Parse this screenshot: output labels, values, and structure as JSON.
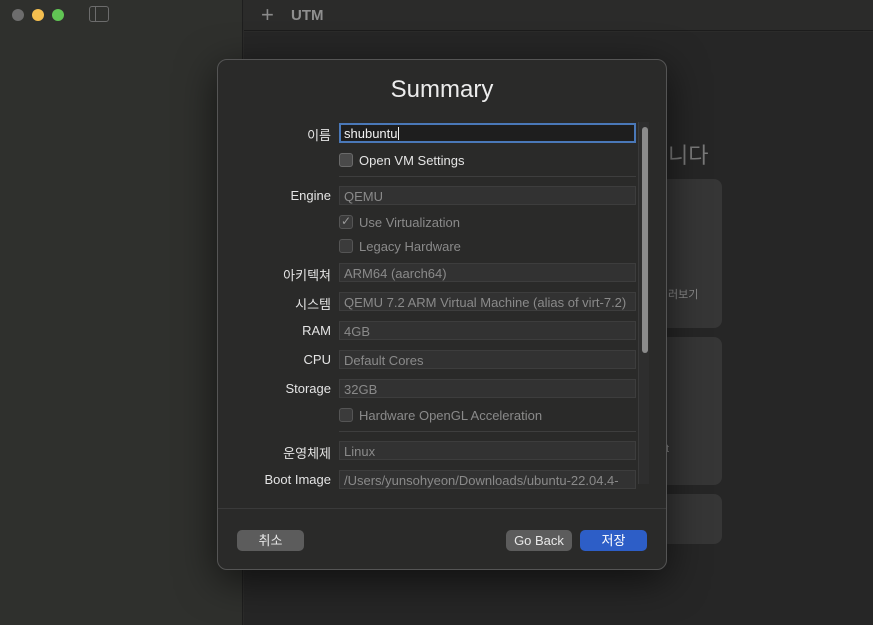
{
  "window": {
    "app_title": "UTM",
    "add_symbol": "+"
  },
  "background": {
    "welcome_fragment": "니다",
    "card_label": "러보기",
    "card_label_2": "t"
  },
  "dialog": {
    "title": "Summary",
    "name": {
      "label": "이름",
      "value": "shubuntu"
    },
    "open_vm_settings": "Open VM Settings",
    "engine": {
      "label": "Engine",
      "value": "QEMU"
    },
    "use_virtualization": "Use Virtualization",
    "legacy_hardware": "Legacy Hardware",
    "architecture": {
      "label": "아키텍쳐",
      "value": "ARM64 (aarch64)"
    },
    "system": {
      "label": "시스템",
      "value": "QEMU 7.2 ARM Virtual Machine (alias of virt-7.2)"
    },
    "ram": {
      "label": "RAM",
      "value": "4GB"
    },
    "cpu": {
      "label": "CPU",
      "value": "Default Cores"
    },
    "storage": {
      "label": "Storage",
      "value": "32GB"
    },
    "hardware_opengl": "Hardware OpenGL Acceleration",
    "os": {
      "label": "운영체제",
      "value": "Linux"
    },
    "boot_image": {
      "label": "Boot Image",
      "value": "/Users/yunsohyeon/Downloads/ubuntu-22.04.4-"
    },
    "buttons": {
      "cancel": "취소",
      "go_back": "Go Back",
      "save": "저장"
    }
  },
  "colors": {
    "accent": "#2d5ec7",
    "focus_ring": "#4a78b8",
    "close": "#6d6d6d",
    "minimize": "#f5bf4f",
    "maximize": "#61c554"
  }
}
